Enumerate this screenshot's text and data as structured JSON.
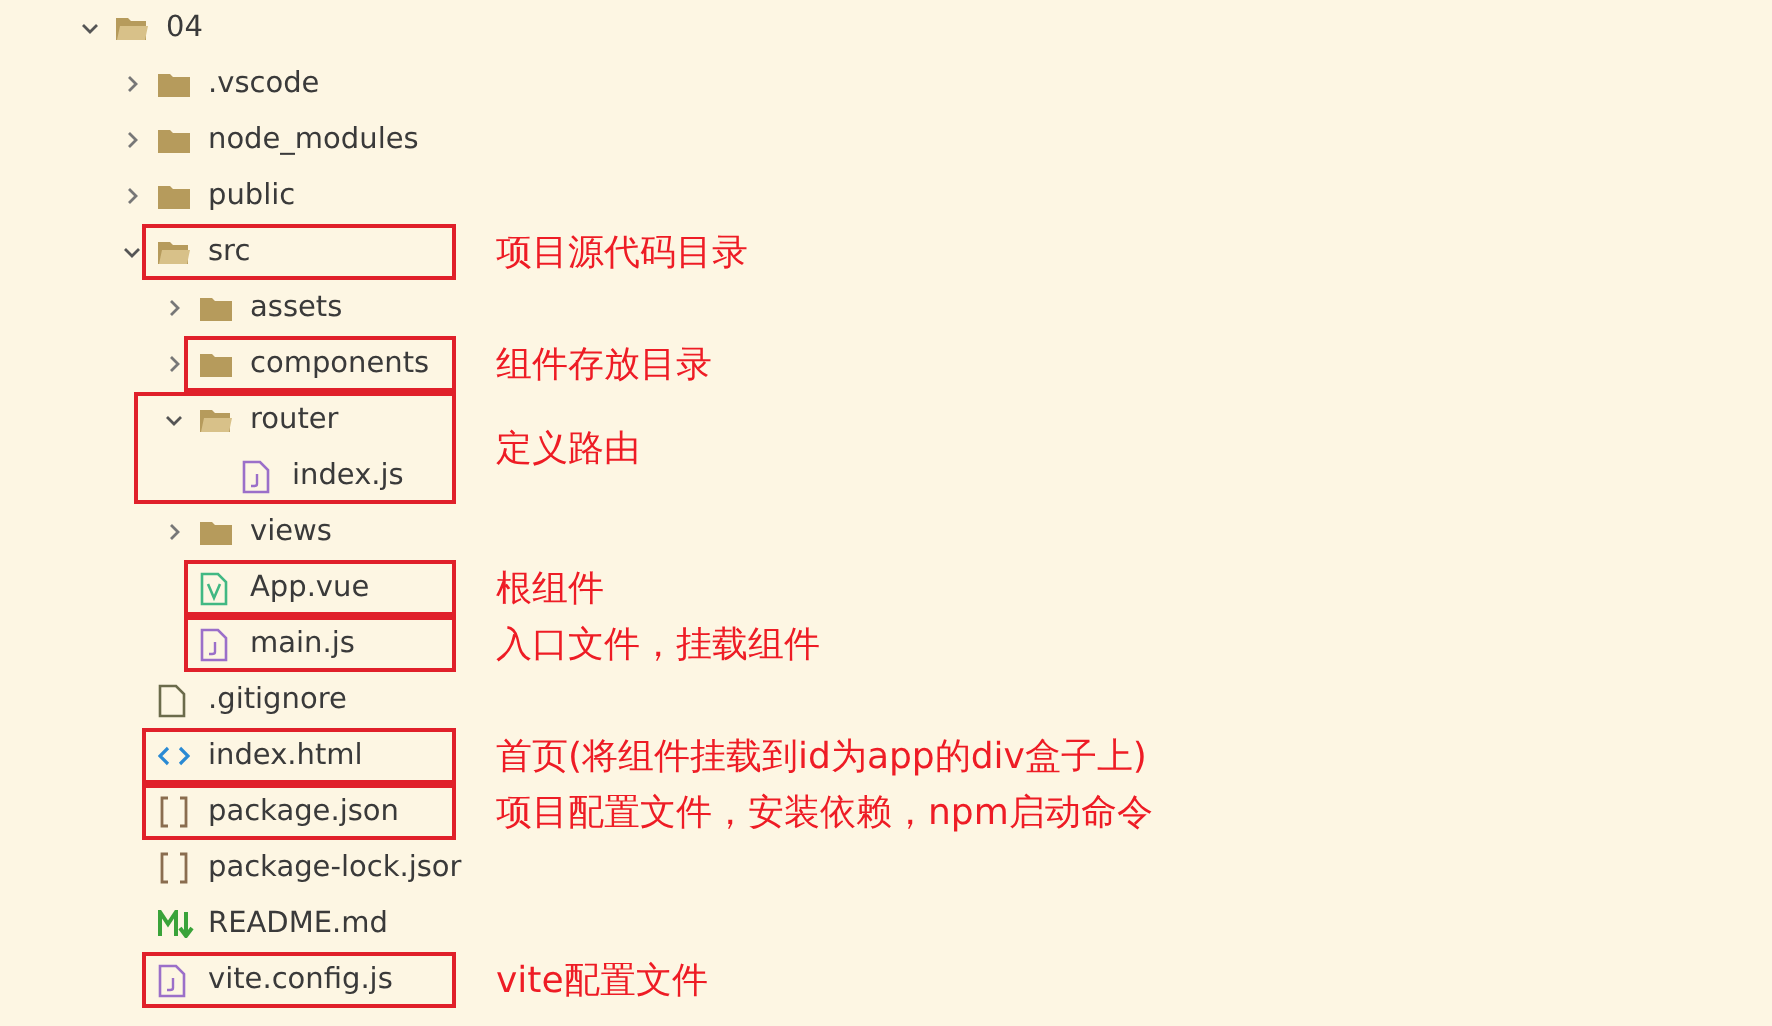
{
  "tree": [
    {
      "name": "04",
      "kind": "folder",
      "expanded": true,
      "children": [
        {
          "name": ".vscode",
          "kind": "folder",
          "expanded": false
        },
        {
          "name": "node_modules",
          "kind": "folder",
          "expanded": false
        },
        {
          "name": "public",
          "kind": "folder",
          "expanded": false
        },
        {
          "name": "src",
          "kind": "folder",
          "expanded": true,
          "highlighted": true,
          "note": "项目源代码目录",
          "children": [
            {
              "name": "assets",
              "kind": "folder",
              "expanded": false
            },
            {
              "name": "components",
              "kind": "folder",
              "expanded": false,
              "highlighted": true,
              "note": "组件存放目录"
            },
            {
              "name": "router",
              "kind": "folder",
              "expanded": true,
              "highlighted": true,
              "frame_spans_children": true,
              "note": "定义路由",
              "children": [
                {
                  "name": "index.js",
                  "kind": "js"
                }
              ]
            },
            {
              "name": "views",
              "kind": "folder",
              "expanded": false
            },
            {
              "name": "App.vue",
              "kind": "vue",
              "highlighted": true,
              "note": "根组件"
            },
            {
              "name": "main.js",
              "kind": "js",
              "highlighted": true,
              "note": "入口文件，挂载组件"
            }
          ]
        },
        {
          "name": ".gitignore",
          "kind": "file"
        },
        {
          "name": "index.html",
          "kind": "html",
          "highlighted": true,
          "note": "首页(将组件挂载到id为app的div盒子上)"
        },
        {
          "name": "package.json",
          "kind": "json",
          "highlighted": true,
          "note": "项目配置文件，安装依赖，npm启动命令"
        },
        {
          "name": "package-lock.jsor",
          "kind": "json"
        },
        {
          "name": "README.md",
          "kind": "markdown"
        },
        {
          "name": "vite.config.js",
          "kind": "js",
          "highlighted": true,
          "note": "vite配置文件"
        }
      ]
    }
  ]
}
